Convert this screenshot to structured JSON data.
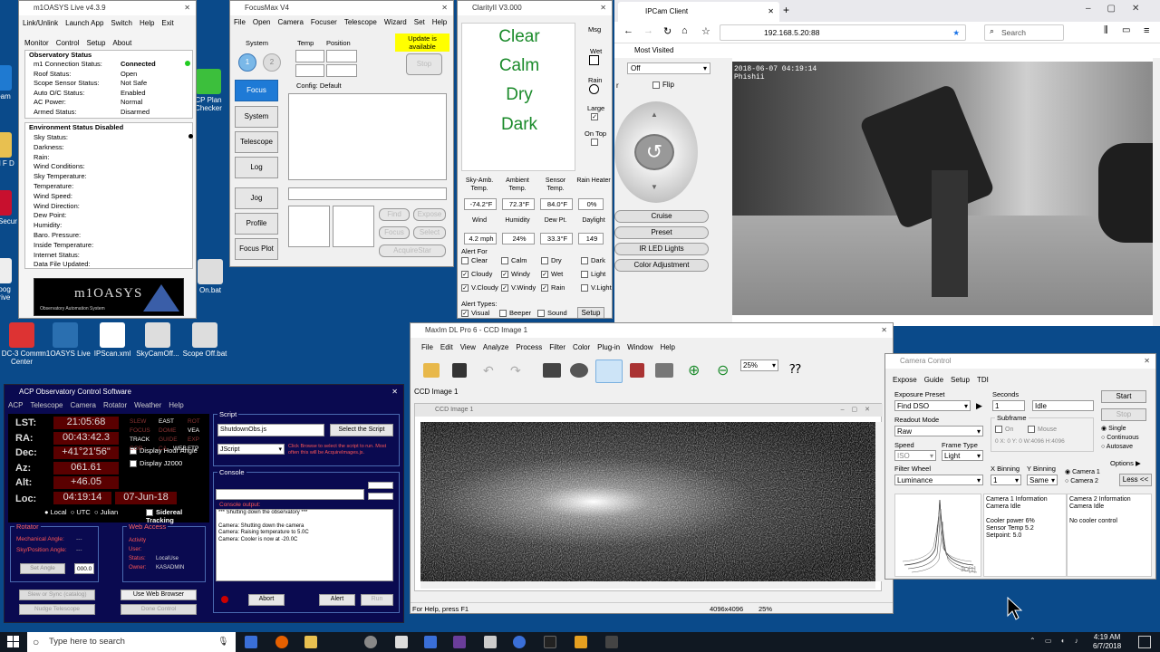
{
  "desktop_icons": [
    {
      "label": "Team"
    },
    {
      "label": "Old F D"
    },
    {
      "label": "Mc Secur"
    },
    {
      "label": "Goog Drive"
    },
    {
      "label": "DC-3 Comm Center"
    },
    {
      "label": "m1OASYS Live"
    },
    {
      "label": "IPScan.xml"
    },
    {
      "label": "SkyCamOff..."
    },
    {
      "label": "Scope Off.bat"
    },
    {
      "label": "CP Plan Checker"
    },
    {
      "label": "On.bat"
    }
  ],
  "m1oasys": {
    "title": "m1OASYS Live v4.3.9",
    "menu": [
      "Link/Unlink",
      "Launch App",
      "Switch",
      "Help",
      "Exit"
    ],
    "tabs": [
      "Monitor",
      "Control",
      "Setup",
      "About"
    ],
    "obs_header": "Observatory Status",
    "obs_rows": [
      {
        "k": "m1 Connection Status:",
        "v": "Connected"
      },
      {
        "k": "Roof Status:",
        "v": "Open"
      },
      {
        "k": "Scope Sensor Status:",
        "v": "Not Safe"
      },
      {
        "k": "Auto O/C Status:",
        "v": "Enabled"
      },
      {
        "k": "AC Power:",
        "v": "Normal"
      },
      {
        "k": "Armed Status:",
        "v": "Disarmed"
      }
    ],
    "env_header": "Environment Status Disabled",
    "env_rows": [
      "Sky Status:",
      "Darkness:",
      "Rain:",
      "Wind Conditions:",
      "Sky Temperature:",
      "Temperature:",
      "Wind Speed:",
      "Wind Direction:",
      "Dew Point:",
      "Humidity:",
      "Baro. Pressure:",
      "Inside Temperature:",
      "Internet Status:",
      "Data File Updated:"
    ],
    "logo": "m1OASYS",
    "logo_sub": "Observatory Automation System"
  },
  "focusmax": {
    "title": "FocusMax V4",
    "menu": [
      "File",
      "Open",
      "Camera",
      "Focuser",
      "Telescope",
      "Wizard",
      "Set",
      "Help"
    ],
    "system_label": "System",
    "temp_label": "Temp",
    "position_label": "Position",
    "update": "Update is available",
    "stop": "Stop",
    "nav": [
      "Focus",
      "System",
      "Telescope",
      "Log",
      "Jog",
      "Profile",
      "Focus Plot"
    ],
    "config": "Config: Default",
    "small_btns": [
      "Find",
      "Expose",
      "Focus",
      "Select",
      "AcquireStar"
    ]
  },
  "clarity": {
    "title": "ClarityII V3.000",
    "status": [
      "Clear",
      "Calm",
      "Dry",
      "Dark"
    ],
    "right": [
      "Msg",
      "Wet",
      "Rain",
      "Large",
      "On Top"
    ],
    "readings": [
      {
        "k": "Sky-Amb. Temp.",
        "v": "-74.2°F"
      },
      {
        "k": "Ambient Temp.",
        "v": "72.3°F"
      },
      {
        "k": "Sensor Temp.",
        "v": "84.0°F"
      },
      {
        "k": "Rain Heater",
        "v": "0%"
      },
      {
        "k": "Wind",
        "v": "4.2 mph"
      },
      {
        "k": "Humidity",
        "v": "24%"
      },
      {
        "k": "Dew Pt.",
        "v": "33.3°F"
      },
      {
        "k": "Daylight",
        "v": "149"
      }
    ],
    "alert_for": "Alert For",
    "alerts": [
      {
        "t": "Clear",
        "c": false
      },
      {
        "t": "Calm",
        "c": false
      },
      {
        "t": "Dry",
        "c": false
      },
      {
        "t": "Dark",
        "c": false
      },
      {
        "t": "Cloudy",
        "c": true
      },
      {
        "t": "Windy",
        "c": true
      },
      {
        "t": "Wet",
        "c": true
      },
      {
        "t": "Light",
        "c": false
      },
      {
        "t": "V.Cloudy",
        "c": true
      },
      {
        "t": "V.Windy",
        "c": true
      },
      {
        "t": "Rain",
        "c": true
      },
      {
        "t": "V.Light",
        "c": false
      }
    ],
    "alert_types": "Alert Types:",
    "types": [
      {
        "t": "Visual",
        "c": true
      },
      {
        "t": "Beeper",
        "c": false
      },
      {
        "t": "Sound",
        "c": false
      }
    ],
    "setup": "Setup"
  },
  "ipcam": {
    "tab": "IPCam Client",
    "url": "192.168.5.20:88",
    "search": "Search",
    "most_visited": "Most Visited",
    "select": "Off",
    "flip": "Flip",
    "side_btns": [
      "Cruise",
      "Preset",
      "IR LED Lights",
      "Color Adjustment"
    ],
    "overlay_time": "2018-06-07 04:19:14",
    "overlay_name": "Phishii",
    "letter_r": "r"
  },
  "acp": {
    "title": "ACP Observatory Control Software",
    "menu": [
      "ACP",
      "Telescope",
      "Camera",
      "Rotator",
      "Weather",
      "Help"
    ],
    "rows": [
      {
        "k": "LST:",
        "v": "21:05:68"
      },
      {
        "k": "RA:",
        "v": "00:43:42.3"
      },
      {
        "k": "Dec:",
        "v": "+41°21'56\""
      },
      {
        "k": "Az:",
        "v": "061.61"
      },
      {
        "k": "Alt:",
        "v": "+46.05"
      }
    ],
    "loc_k": "Loc:",
    "loc_time": "04:19:14",
    "loc_date": "07-Jun-18",
    "status_cols": [
      [
        "SLEW",
        "FOCUS",
        "TRACK",
        "COR"
      ],
      [
        "EAST",
        "DOME",
        "GUIDE",
        "CA"
      ],
      [
        "ROT",
        "VEA",
        "EXP",
        "FTP"
      ]
    ],
    "web": "WEB",
    "chk": [
      "Display Hour Angle",
      "Display J2000"
    ],
    "radios": [
      "Local",
      "UTC",
      "Julian"
    ],
    "sidereal": "Sidereal Tracking",
    "rotator": "Rotator",
    "mech": "Mechanical Angle:",
    "mech_v": "---",
    "skypos": "Sky/Position Angle:",
    "skypos_v": "---",
    "set_angle": "Set Angle",
    "angle_val": "000.0",
    "web_access": "Web Access",
    "wa_rows": [
      {
        "k": "Activity",
        "v": ""
      },
      {
        "k": "User:",
        "v": ""
      },
      {
        "k": "Status:",
        "v": "LocalUse"
      },
      {
        "k": "Owner:",
        "v": "KASADMIN"
      }
    ],
    "slew_sync": "Slew or Sync (catalog)",
    "nudge": "Nudge Telescope",
    "use_web": "Use Web Browser",
    "done": "Done Control",
    "script_label": "Script",
    "script_val": "ShutdownObs.js",
    "select_script": "Select the Script",
    "lang": "JScript",
    "hint": "Click Browse to select the script to run. Most often this will be AcquireImages.js.",
    "console": "Console",
    "console_output": "Console output:",
    "console_lines": [
      "*** Shutting down the observatory ***",
      "",
      "Camera: Shutting down the camera",
      "Camera: Raising temperature to 5.0C",
      "Camera: Cooler is now at -20.0C"
    ],
    "abort": "Abort",
    "alert": "Alert",
    "run": "Run"
  },
  "maxim": {
    "title": "MaxIm DL Pro 6 - CCD Image 1",
    "menu": [
      "File",
      "Edit",
      "View",
      "Analyze",
      "Process",
      "Filter",
      "Color",
      "Plug-in",
      "Window",
      "Help"
    ],
    "zoom": "25%",
    "tab": "CCD Image 1",
    "inner": "CCD Image 1",
    "status": "For Help, press F1",
    "dims": "4096x4096",
    "zoom2": "25%"
  },
  "camctl": {
    "title": "Camera Control",
    "tabs": [
      "Expose",
      "Guide",
      "Setup",
      "TDI"
    ],
    "preset_l": "Exposure Preset",
    "preset": "Find DSO",
    "seconds_l": "Seconds",
    "seconds": "1",
    "idle": "Idle",
    "start": "Start",
    "stop": "Stop",
    "readout_l": "Readout Mode",
    "readout": "Raw",
    "subframe": "Subframe",
    "on": "On",
    "mouse": "Mouse",
    "coords": "0 X: 0 Y: 0 W:4096 H:4096",
    "speed_l": "Speed",
    "speed": "ISO",
    "frame_l": "Frame Type",
    "frame": "Light",
    "single": "Single",
    "continuous": "Continuous",
    "autosave": "Autosave",
    "options": "Options",
    "filter_l": "Filter Wheel",
    "filter": "Luminance",
    "xbin_l": "X Binning",
    "xbin": "1",
    "ybin_l": "Y Binning",
    "ybin": "Same",
    "cam1": "Camera 1",
    "cam2": "Camera 2",
    "less": "Less <<",
    "c1_info": [
      "Camera 1 Information",
      "Camera Idle",
      "",
      "Cooler power 6%",
      "Sensor Temp 5.2",
      "Setpoint: 5.0"
    ],
    "c2_info": [
      "Camera 2 Information",
      "Camera Idle",
      "",
      "No cooler control"
    ],
    "plot_label": "3D[1]"
  },
  "taskbar": {
    "search": "Type here to search",
    "time": "4:19 AM",
    "date": "6/7/2018"
  }
}
